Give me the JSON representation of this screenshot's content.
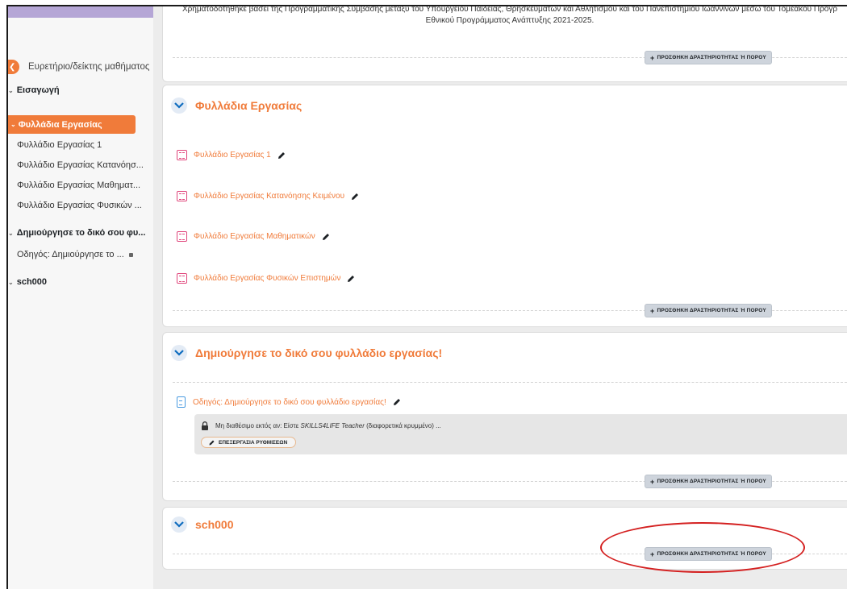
{
  "intro": {
    "line1": "Χρηματοδοτήθηκε βάσει της Προγραμματικής Σύμβασης μεταξύ του Υπουργείου Παιδείας, Θρησκευμάτων και Αθλητισμού και του Πανεπιστημίου Ιωαννίνων μέσω του Τομεακού Προγρ",
    "line2": "Εθνικού Προγράμματος Ανάπτυξης 2021-2025."
  },
  "add_button_label": "ΠΡΟΣΘΗΚΗ ΔΡΑΣΤΗΡΙΟΤΗΤΑΣ Ή ΠΟΡΟΥ",
  "sidebar": {
    "index_label": "Ευρετήριο/δείκτης μαθήματος",
    "sections": [
      {
        "label": "Εισαγωγή"
      },
      {
        "label": "Φυλλάδια Εργασίας",
        "active": true,
        "items": [
          "Φυλλάδιο Εργασίας 1",
          "Φυλλάδιο Εργασίας Κατανόησ...",
          "Φυλλάδιο Εργασίας Μαθηματ...",
          "Φυλλάδιο Εργασίας Φυσικών ..."
        ]
      },
      {
        "label": "Δημιούργησε το δικό σου φυ...",
        "items": [
          "Οδηγός: Δημιούργησε το ..."
        ]
      },
      {
        "label": "sch000"
      }
    ]
  },
  "sections": [
    {
      "title": "Φυλλάδια Εργασίας",
      "activities": [
        "Φυλλάδιο Εργασίας 1",
        "Φυλλάδιο Εργασίας Κατανόησης Κειμένου",
        "Φυλλάδιο Εργασίας Μαθηματικών",
        "Φυλλάδιο Εργασίας Φυσικών Επιστημών"
      ]
    },
    {
      "title": "Δημιούργησε το δικό σου φυλλάδιο εργασίας!",
      "page_activity": "Οδηγός: Δημιούργησε το δικό σου φυλλάδιο εργασίας!",
      "restriction": {
        "prefix": "Μη διαθέσιμο εκτός αν: Είστε",
        "role": "SKILLS4LIFE Teacher",
        "suffix": "(διαφορετικά κρυμμένο) ..."
      },
      "edit_settings_label": "ΕΠΕΞΕΡΓΑΣΙΑ ΡΥΘΜΙΣΕΩΝ"
    },
    {
      "title": "sch000"
    }
  ],
  "colors": {
    "accent": "#f07b3a",
    "activity_icon": "#e0457b",
    "page_icon": "#4a9be0",
    "highlight_ellipse": "#d42020",
    "top_bar": "#b5a6d6"
  }
}
